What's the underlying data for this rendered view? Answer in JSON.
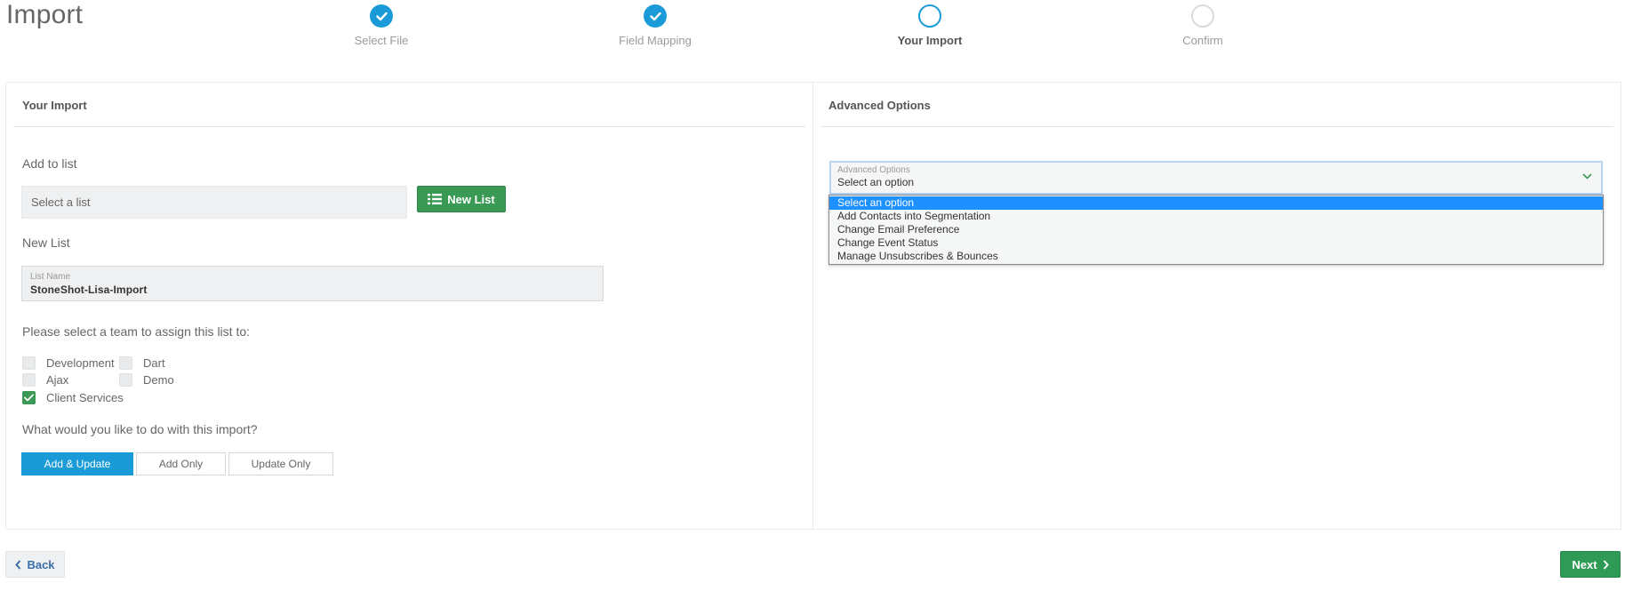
{
  "page": {
    "title": "Import"
  },
  "stepper": {
    "steps": [
      {
        "label": "Select File",
        "state": "done"
      },
      {
        "label": "Field Mapping",
        "state": "done"
      },
      {
        "label": "Your Import",
        "state": "current"
      },
      {
        "label": "Confirm",
        "state": "todo"
      }
    ]
  },
  "left_panel": {
    "heading": "Your Import",
    "add_to_list_label": "Add to list",
    "list_select_placeholder": "Select a list",
    "new_list_button": "New List",
    "new_list_label": "New List",
    "list_name": {
      "label": "List Name",
      "value": "StoneShot-Lisa-Import"
    },
    "team_prompt": "Please select a team to assign this list to:",
    "teams": [
      {
        "label": "Development",
        "checked": false
      },
      {
        "label": "Dart",
        "checked": false
      },
      {
        "label": "Ajax",
        "checked": false
      },
      {
        "label": "Demo",
        "checked": false
      },
      {
        "label": "Client Services",
        "checked": true
      }
    ],
    "import_prompt": "What would you like to do with this import?",
    "import_modes": [
      {
        "label": "Add & Update",
        "active": true
      },
      {
        "label": "Add Only",
        "active": false
      },
      {
        "label": "Update Only",
        "active": false
      }
    ]
  },
  "right_panel": {
    "heading": "Advanced Options",
    "select": {
      "label": "Advanced Options",
      "value": "Select an option",
      "options": [
        "Select an option",
        "Add Contacts into Segmentation",
        "Change Email Preference",
        "Change Event Status",
        "Manage Unsubscribes & Bounces"
      ],
      "highlighted_index": 0
    }
  },
  "footer": {
    "back_label": "Back",
    "next_label": "Next"
  },
  "colors": {
    "accent_blue": "#1a9bd8",
    "success_green": "#3a9a55",
    "option_highlight": "#1e90ff"
  }
}
